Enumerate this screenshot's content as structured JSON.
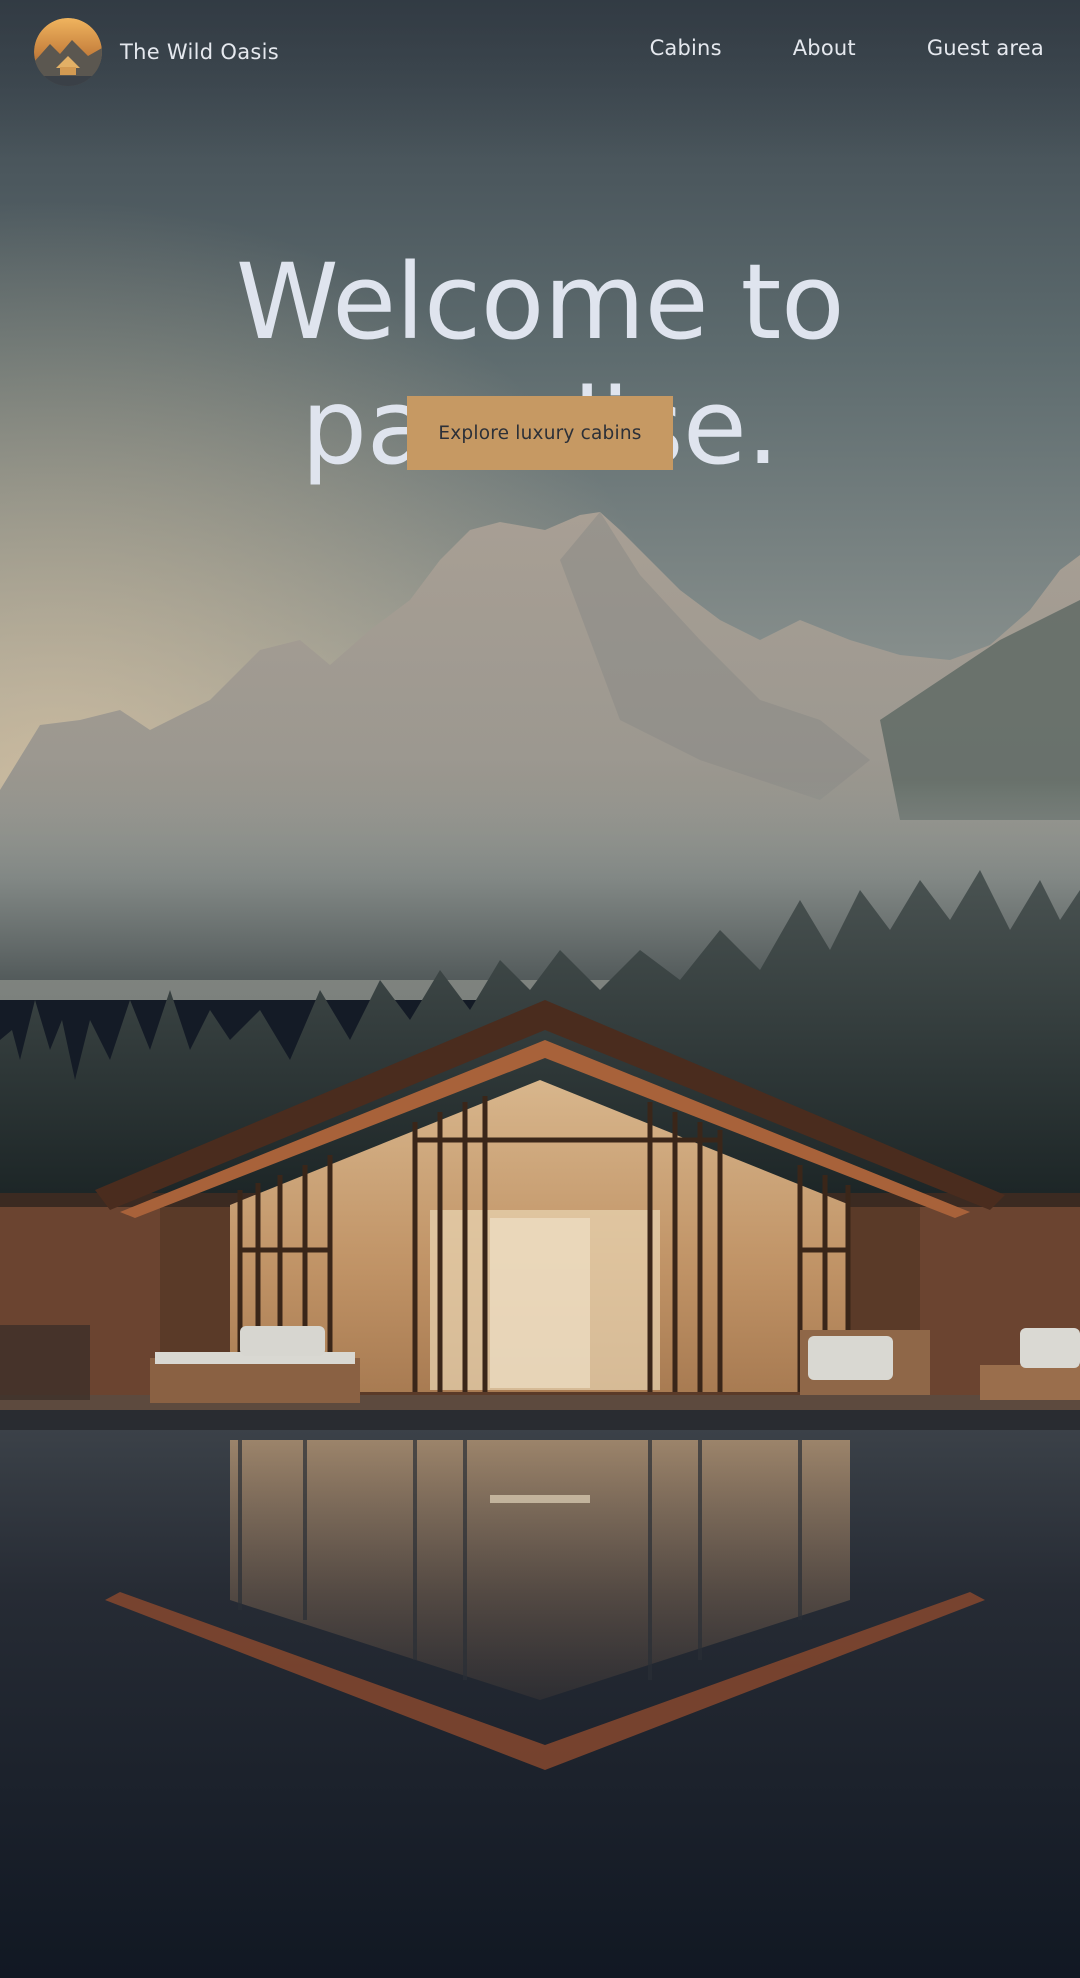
{
  "brand": {
    "name": "The Wild Oasis",
    "logo_icon": "cabin-logo-icon"
  },
  "nav": {
    "items": [
      "Cabins",
      "About",
      "Guest area"
    ]
  },
  "hero": {
    "headline": "Welcome to paradise.",
    "cta_label": "Explore luxury cabins",
    "image": "mountain-cabin-lake-photo"
  },
  "colors": {
    "accent": "#c69963",
    "text": "#e5e8ee",
    "sky_top": "#3c4650",
    "water": "#141b26"
  }
}
